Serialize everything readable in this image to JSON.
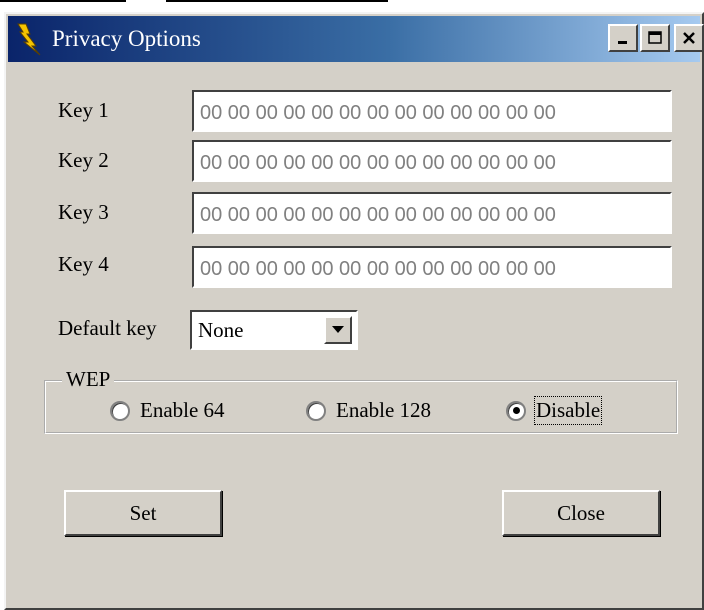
{
  "window": {
    "title": "Privacy Options",
    "icon": "lightning-bolt-icon",
    "controls": [
      "minimize-icon",
      "maximize-icon",
      "close-icon"
    ]
  },
  "keys": [
    {
      "label": "Key 1",
      "value": "00 00 00 00 00 00 00 00 00 00 00 00 00"
    },
    {
      "label": "Key 2",
      "value": "00 00 00 00 00 00 00 00 00 00 00 00 00"
    },
    {
      "label": "Key 3",
      "value": "00 00 00 00 00 00 00 00 00 00 00 00 00"
    },
    {
      "label": "Key 4",
      "value": "00 00 00 00 00 00 00 00 00 00 00 00 00"
    }
  ],
  "default_key": {
    "label": "Default key",
    "selected": "None"
  },
  "wep": {
    "legend": "WEP",
    "options": [
      {
        "label": "Enable 64",
        "checked": false
      },
      {
        "label": "Enable 128",
        "checked": false
      },
      {
        "label": "Disable",
        "checked": true
      }
    ]
  },
  "buttons": {
    "set": "Set",
    "close": "Close"
  }
}
